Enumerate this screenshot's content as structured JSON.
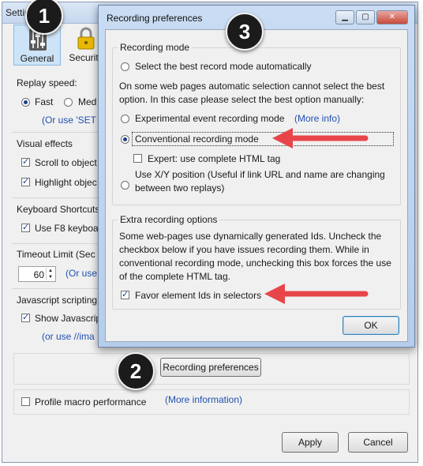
{
  "settings_window": {
    "title": "Settin",
    "toolbar": [
      {
        "label": "General"
      },
      {
        "label": "Security"
      }
    ],
    "replay_speed": {
      "label": "Replay speed:",
      "option_fast": "Fast",
      "option_medium": "Med",
      "hint": "(Or use 'SET !"
    },
    "visual_effects": {
      "label": "Visual effects",
      "scroll": "Scroll to object",
      "highlight": "Highlight objec"
    },
    "keyboard_shortcuts": {
      "label": "Keyboard Shortcuts",
      "use_f8": "Use F8 keyboar"
    },
    "timeout": {
      "label": "Timeout Limit (Sec",
      "value": "60",
      "hint": "(Or use '"
    },
    "javascript": {
      "label": "Javascript scripting",
      "show": "Show Javascrip",
      "hint": "(or use //ima"
    },
    "recording_preferences_button": "Recording preferences",
    "profile_macro": "Profile macro performance",
    "more_information": "(More information)",
    "apply_button": "Apply",
    "cancel_button": "Cancel"
  },
  "badges": [
    "1",
    "2",
    "3"
  ],
  "dialog": {
    "title": "Recording preferences",
    "recording_mode": {
      "legend": "Recording mode",
      "auto": "Select the best record mode automatically",
      "note_line1": "On some web pages automatic selection cannot select the best",
      "note_line2": "option. In this case please select the best option manually:",
      "experimental": "Experimental event recording mode",
      "more_info": "(More info)",
      "conventional": "Conventional recording mode",
      "expert": "Expert: use complete HTML tag",
      "xy_line1": "Use X/Y position (Useful if link URL and name are changing",
      "xy_line2": "between two replays)"
    },
    "extra": {
      "legend": "Extra recording options",
      "text_line1": "Some web-pages use dynamically generated Ids. Uncheck the",
      "text_line2": "checkbox below if you have issues recording them. While in",
      "text_line3": "conventional recording mode, unchecking this box forces the use",
      "text_line4": "of the complete HTML tag.",
      "favor_ids": "Favor element Ids in selectors"
    },
    "ok_button": "OK"
  },
  "colors": {
    "arrow": "#e8454a",
    "badge": "#1b1b1b",
    "link": "#2050b0"
  }
}
